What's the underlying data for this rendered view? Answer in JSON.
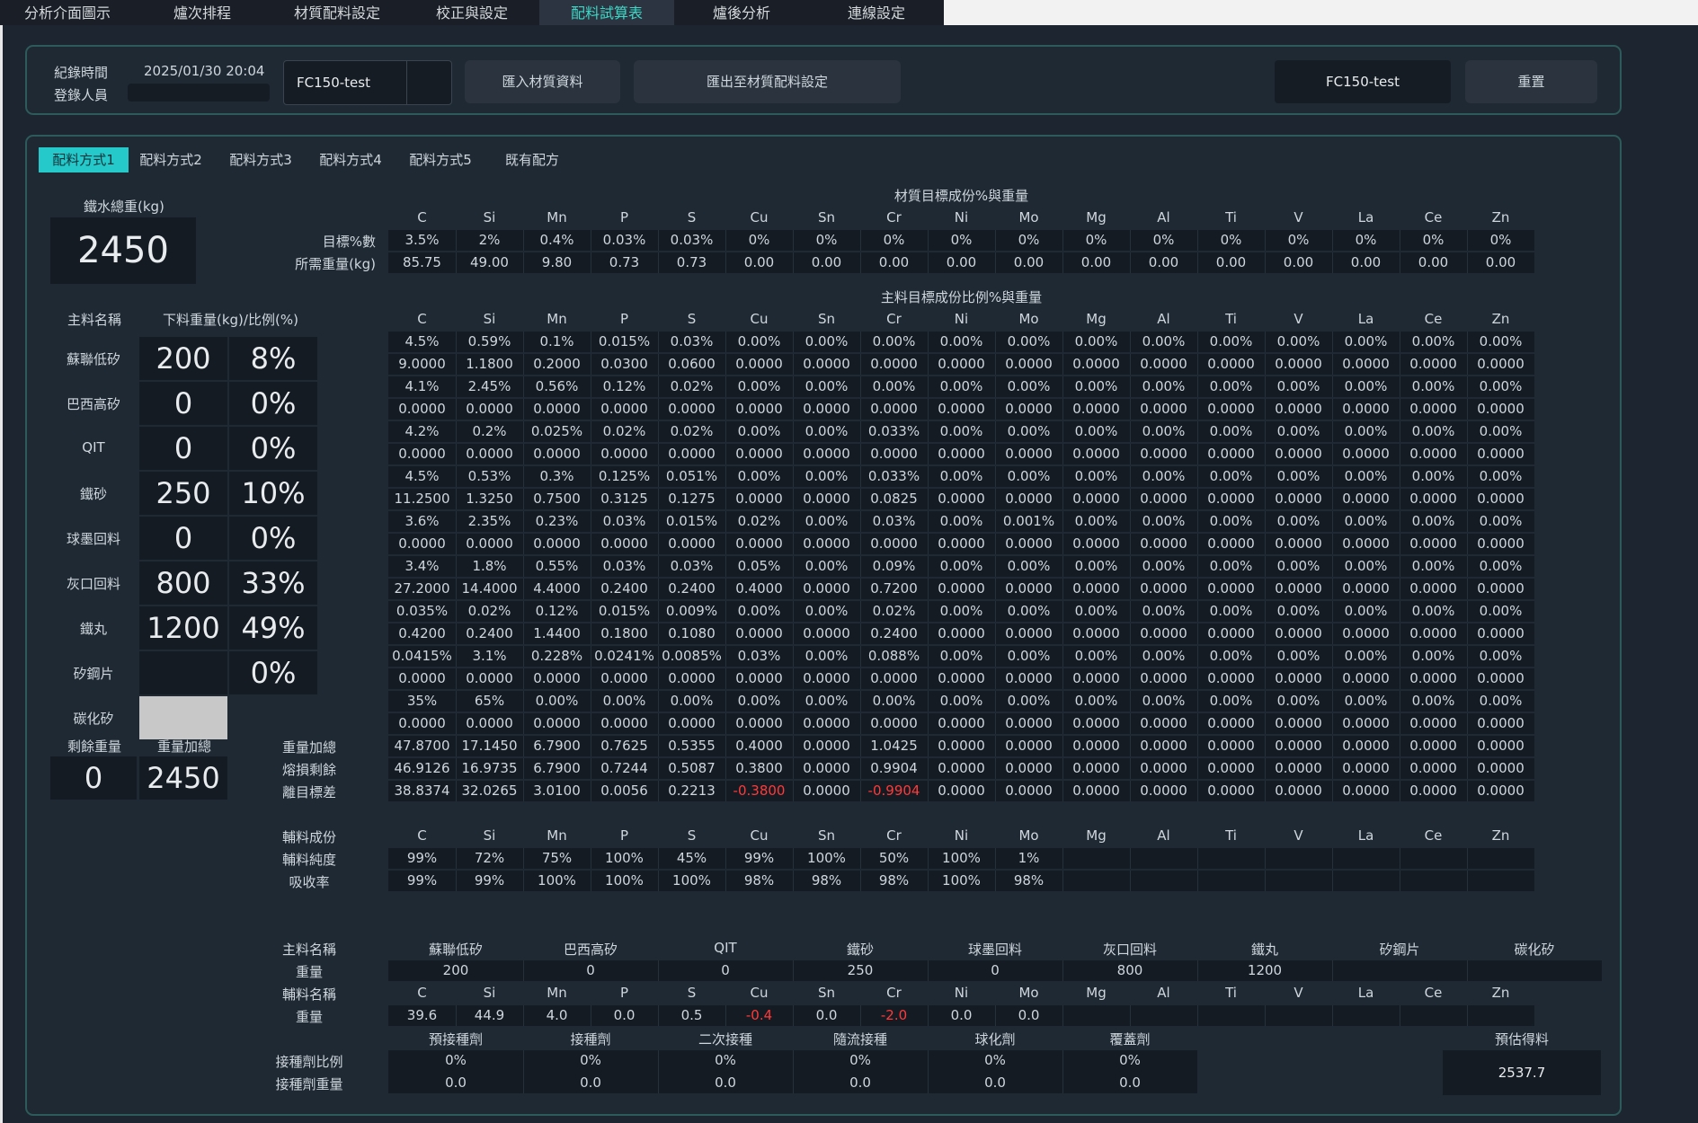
{
  "menu": [
    {
      "label": "分析介面圖示",
      "active": false
    },
    {
      "label": "爐次排程",
      "active": false
    },
    {
      "label": "材質配料設定",
      "active": false
    },
    {
      "label": "校正與設定",
      "active": false
    },
    {
      "label": "配料試算表",
      "active": true
    },
    {
      "label": "爐後分析",
      "active": false
    },
    {
      "label": "連線設定",
      "active": false
    }
  ],
  "header": {
    "record_time_label": "紀錄時間",
    "record_time": "2025/01/30 20:04",
    "user_label": "登錄人員",
    "user_value": "",
    "material_select": "FC150-test",
    "import_btn": "匯入材質資料",
    "export_btn": "匯出至材質配料設定",
    "current_material": "FC150-test",
    "reset_btn": "重置"
  },
  "tabs": [
    "配料方式1",
    "配料方式2",
    "配料方式3",
    "配料方式4",
    "配料方式5",
    "既有配方"
  ],
  "elements": [
    "C",
    "Si",
    "Mn",
    "P",
    "S",
    "Cu",
    "Sn",
    "Cr",
    "Ni",
    "Mo",
    "Mg",
    "Al",
    "Ti",
    "V",
    "La",
    "Ce",
    "Zn"
  ],
  "left": {
    "total_label": "鐵水總重(kg)",
    "total": "2450",
    "name_hdr": "主料名稱",
    "weight_hdr": "下料重量(kg)/比例(%)",
    "materials": [
      {
        "name": "蘇聯低矽",
        "weight": "200",
        "pct": "8%"
      },
      {
        "name": "巴西高矽",
        "weight": "0",
        "pct": "0%"
      },
      {
        "name": "QIT",
        "weight": "0",
        "pct": "0%"
      },
      {
        "name": "鐵砂",
        "weight": "250",
        "pct": "10%"
      },
      {
        "name": "球墨回料",
        "weight": "0",
        "pct": "0%"
      },
      {
        "name": "灰口回料",
        "weight": "800",
        "pct": "33%"
      },
      {
        "name": "鐵丸",
        "weight": "1200",
        "pct": "49%"
      },
      {
        "name": "矽鋼片",
        "weight": "",
        "pct": "0%"
      },
      {
        "name": "碳化矽",
        "weight": "",
        "pct": ""
      }
    ],
    "remain_label": "剩餘重量",
    "remain": "0",
    "sum_label": "重量加總",
    "sum": "2450"
  },
  "target": {
    "title": "材質目標成份%與重量",
    "rows": [
      {
        "label": "目標%數",
        "values": [
          "3.5%",
          "2%",
          "0.4%",
          "0.03%",
          "0.03%",
          "0%",
          "0%",
          "0%",
          "0%",
          "0%",
          "0%",
          "0%",
          "0%",
          "0%",
          "0%",
          "0%",
          "0%"
        ]
      },
      {
        "label": "所需重量(kg)",
        "values": [
          "85.75",
          "49.00",
          "9.80",
          "0.73",
          "0.73",
          "0.00",
          "0.00",
          "0.00",
          "0.00",
          "0.00",
          "0.00",
          "0.00",
          "0.00",
          "0.00",
          "0.00",
          "0.00",
          "0.00"
        ]
      }
    ]
  },
  "main_comp": {
    "title": "主料目標成份比例%與重量",
    "rows": [
      [
        "4.5%",
        "0.59%",
        "0.1%",
        "0.015%",
        "0.03%",
        "0.00%",
        "0.00%",
        "0.00%",
        "0.00%",
        "0.00%",
        "0.00%",
        "0.00%",
        "0.00%",
        "0.00%",
        "0.00%",
        "0.00%",
        "0.00%"
      ],
      [
        "9.0000",
        "1.1800",
        "0.2000",
        "0.0300",
        "0.0600",
        "0.0000",
        "0.0000",
        "0.0000",
        "0.0000",
        "0.0000",
        "0.0000",
        "0.0000",
        "0.0000",
        "0.0000",
        "0.0000",
        "0.0000",
        "0.0000"
      ],
      [
        "4.1%",
        "2.45%",
        "0.56%",
        "0.12%",
        "0.02%",
        "0.00%",
        "0.00%",
        "0.00%",
        "0.00%",
        "0.00%",
        "0.00%",
        "0.00%",
        "0.00%",
        "0.00%",
        "0.00%",
        "0.00%",
        "0.00%"
      ],
      [
        "0.0000",
        "0.0000",
        "0.0000",
        "0.0000",
        "0.0000",
        "0.0000",
        "0.0000",
        "0.0000",
        "0.0000",
        "0.0000",
        "0.0000",
        "0.0000",
        "0.0000",
        "0.0000",
        "0.0000",
        "0.0000",
        "0.0000"
      ],
      [
        "4.2%",
        "0.2%",
        "0.025%",
        "0.02%",
        "0.02%",
        "0.00%",
        "0.00%",
        "0.033%",
        "0.00%",
        "0.00%",
        "0.00%",
        "0.00%",
        "0.00%",
        "0.00%",
        "0.00%",
        "0.00%",
        "0.00%"
      ],
      [
        "0.0000",
        "0.0000",
        "0.0000",
        "0.0000",
        "0.0000",
        "0.0000",
        "0.0000",
        "0.0000",
        "0.0000",
        "0.0000",
        "0.0000",
        "0.0000",
        "0.0000",
        "0.0000",
        "0.0000",
        "0.0000",
        "0.0000"
      ],
      [
        "4.5%",
        "0.53%",
        "0.3%",
        "0.125%",
        "0.051%",
        "0.00%",
        "0.00%",
        "0.033%",
        "0.00%",
        "0.00%",
        "0.00%",
        "0.00%",
        "0.00%",
        "0.00%",
        "0.00%",
        "0.00%",
        "0.00%"
      ],
      [
        "11.2500",
        "1.3250",
        "0.7500",
        "0.3125",
        "0.1275",
        "0.0000",
        "0.0000",
        "0.0825",
        "0.0000",
        "0.0000",
        "0.0000",
        "0.0000",
        "0.0000",
        "0.0000",
        "0.0000",
        "0.0000",
        "0.0000"
      ],
      [
        "3.6%",
        "2.35%",
        "0.23%",
        "0.03%",
        "0.015%",
        "0.02%",
        "0.00%",
        "0.03%",
        "0.00%",
        "0.001%",
        "0.00%",
        "0.00%",
        "0.00%",
        "0.00%",
        "0.00%",
        "0.00%",
        "0.00%"
      ],
      [
        "0.0000",
        "0.0000",
        "0.0000",
        "0.0000",
        "0.0000",
        "0.0000",
        "0.0000",
        "0.0000",
        "0.0000",
        "0.0000",
        "0.0000",
        "0.0000",
        "0.0000",
        "0.0000",
        "0.0000",
        "0.0000",
        "0.0000"
      ],
      [
        "3.4%",
        "1.8%",
        "0.55%",
        "0.03%",
        "0.03%",
        "0.05%",
        "0.00%",
        "0.09%",
        "0.00%",
        "0.00%",
        "0.00%",
        "0.00%",
        "0.00%",
        "0.00%",
        "0.00%",
        "0.00%",
        "0.00%"
      ],
      [
        "27.2000",
        "14.4000",
        "4.4000",
        "0.2400",
        "0.2400",
        "0.4000",
        "0.0000",
        "0.7200",
        "0.0000",
        "0.0000",
        "0.0000",
        "0.0000",
        "0.0000",
        "0.0000",
        "0.0000",
        "0.0000",
        "0.0000"
      ],
      [
        "0.035%",
        "0.02%",
        "0.12%",
        "0.015%",
        "0.009%",
        "0.00%",
        "0.00%",
        "0.02%",
        "0.00%",
        "0.00%",
        "0.00%",
        "0.00%",
        "0.00%",
        "0.00%",
        "0.00%",
        "0.00%",
        "0.00%"
      ],
      [
        "0.4200",
        "0.2400",
        "1.4400",
        "0.1800",
        "0.1080",
        "0.0000",
        "0.0000",
        "0.2400",
        "0.0000",
        "0.0000",
        "0.0000",
        "0.0000",
        "0.0000",
        "0.0000",
        "0.0000",
        "0.0000",
        "0.0000"
      ],
      [
        "0.0415%",
        "3.1%",
        "0.228%",
        "0.0241%",
        "0.0085%",
        "0.03%",
        "0.00%",
        "0.088%",
        "0.00%",
        "0.00%",
        "0.00%",
        "0.00%",
        "0.00%",
        "0.00%",
        "0.00%",
        "0.00%",
        "0.00%"
      ],
      [
        "0.0000",
        "0.0000",
        "0.0000",
        "0.0000",
        "0.0000",
        "0.0000",
        "0.0000",
        "0.0000",
        "0.0000",
        "0.0000",
        "0.0000",
        "0.0000",
        "0.0000",
        "0.0000",
        "0.0000",
        "0.0000",
        "0.0000"
      ],
      [
        "35%",
        "65%",
        "0.00%",
        "0.00%",
        "0.00%",
        "0.00%",
        "0.00%",
        "0.00%",
        "0.00%",
        "0.00%",
        "0.00%",
        "0.00%",
        "0.00%",
        "0.00%",
        "0.00%",
        "0.00%",
        "0.00%"
      ],
      [
        "0.0000",
        "0.0000",
        "0.0000",
        "0.0000",
        "0.0000",
        "0.0000",
        "0.0000",
        "0.0000",
        "0.0000",
        "0.0000",
        "0.0000",
        "0.0000",
        "0.0000",
        "0.0000",
        "0.0000",
        "0.0000",
        "0.0000"
      ]
    ],
    "sum_rows": [
      {
        "label": "重量加總",
        "values": [
          "47.8700",
          "17.1450",
          "6.7900",
          "0.7625",
          "0.5355",
          "0.4000",
          "0.0000",
          "1.0425",
          "0.0000",
          "0.0000",
          "0.0000",
          "0.0000",
          "0.0000",
          "0.0000",
          "0.0000",
          "0.0000",
          "0.0000"
        ]
      },
      {
        "label": "熔損剩餘",
        "values": [
          "46.9126",
          "16.9735",
          "6.7900",
          "0.7244",
          "0.5087",
          "0.3800",
          "0.0000",
          "0.9904",
          "0.0000",
          "0.0000",
          "0.0000",
          "0.0000",
          "0.0000",
          "0.0000",
          "0.0000",
          "0.0000",
          "0.0000"
        ]
      },
      {
        "label": "離目標差",
        "values": [
          "38.8374",
          "32.0265",
          "3.0100",
          "0.0056",
          "0.2213",
          "-0.3800",
          "0.0000",
          "-0.9904",
          "0.0000",
          "0.0000",
          "0.0000",
          "0.0000",
          "0.0000",
          "0.0000",
          "0.0000",
          "0.0000",
          "0.0000"
        ]
      }
    ]
  },
  "aux": {
    "hdr_label": "輔料成份",
    "rows": [
      {
        "label": "輔料純度",
        "values": [
          "99%",
          "72%",
          "75%",
          "100%",
          "45%",
          "99%",
          "100%",
          "50%",
          "100%",
          "1%",
          "",
          "",
          "",
          "",
          "",
          "",
          ""
        ]
      },
      {
        "label": "吸收率",
        "values": [
          "99%",
          "99%",
          "100%",
          "100%",
          "100%",
          "98%",
          "98%",
          "98%",
          "100%",
          "98%",
          "",
          "",
          "",
          "",
          "",
          "",
          ""
        ]
      }
    ]
  },
  "summary": {
    "main_name_label": "主料名稱",
    "main_names": [
      "蘇聯低矽",
      "巴西高矽",
      "QIT",
      "鐵砂",
      "球墨回料",
      "灰口回料",
      "鐵丸",
      "矽鋼片",
      "碳化矽"
    ],
    "main_weight_label": "重量",
    "main_weights": [
      "200",
      "0",
      "0",
      "250",
      "0",
      "800",
      "1200",
      "",
      ""
    ],
    "aux_name_label": "輔料名稱",
    "aux_weight_label": "重量",
    "aux_weights": [
      "39.6",
      "44.9",
      "4.0",
      "0.0",
      "0.5",
      "-0.4",
      "0.0",
      "-2.0",
      "0.0",
      "0.0",
      "",
      "",
      "",
      "",
      "",
      "",
      ""
    ],
    "inoc_headers": [
      "預接種劑",
      "接種劑",
      "二次接種",
      "隨流接種",
      "球化劑",
      "覆蓋劑"
    ],
    "inoc_ratio_label": "接種劑比例",
    "inoc_ratios": [
      "0%",
      "0%",
      "0%",
      "0%",
      "0%",
      "0%"
    ],
    "inoc_weight_label": "接種劑重量",
    "inoc_weights": [
      "0.0",
      "0.0",
      "0.0",
      "0.0",
      "0.0",
      "0.0"
    ],
    "yield_label": "預估得料",
    "yield_value": "2537.7"
  },
  "colors": {
    "accent": "#25c9c9",
    "negative": "#ff3a3a",
    "panel_border": "#2d5a5a"
  }
}
